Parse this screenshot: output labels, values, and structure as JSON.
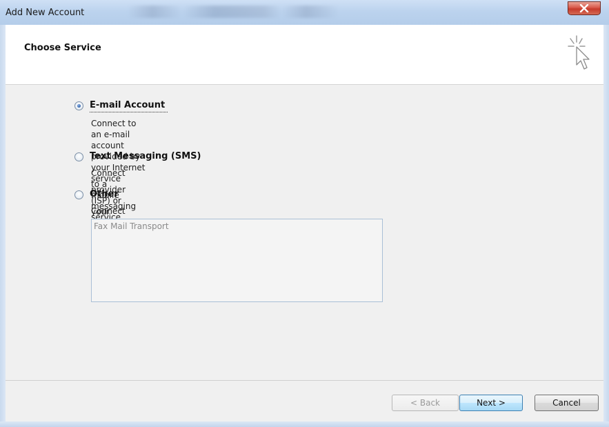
{
  "window": {
    "title": "Add New Account"
  },
  "header": {
    "heading": "Choose Service"
  },
  "options": [
    {
      "label": "E-mail Account",
      "checked": true,
      "description": [
        "Connect to an e-mail account provided by your Internet service provider (ISP) or",
        "your organization."
      ]
    },
    {
      "label": "Text Messaging (SMS)",
      "checked": false,
      "description": [
        "Connect to a mobile messaging service."
      ]
    },
    {
      "label": "Other",
      "checked": false,
      "description": [
        "Connect to a server type shown below."
      ]
    }
  ],
  "server_types": [
    "Fax Mail Transport"
  ],
  "buttons": {
    "back": "< Back",
    "next": "Next >",
    "cancel": "Cancel"
  },
  "icons": {
    "close": "close-icon",
    "wizard": "wizard-cursor-icon"
  },
  "colors": {
    "titlebar": "#bcd3ee",
    "close": "#c63b2b",
    "panel": "#f0f0f0",
    "primary_button_border": "#3c7fb1"
  }
}
